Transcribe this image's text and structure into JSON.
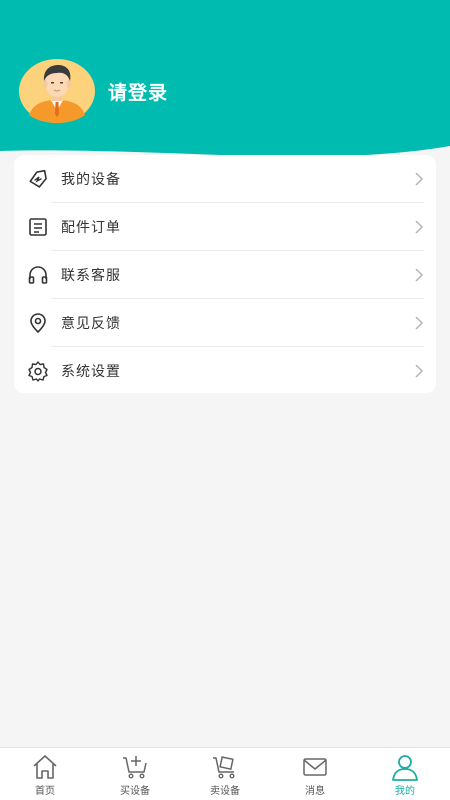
{
  "theme": {
    "accent": "#00bcb0",
    "active_tab": "#1aaea3"
  },
  "header": {
    "avatar_icon": "user-avatar",
    "login_text": "请登录"
  },
  "menu": {
    "items": [
      {
        "label": "我的设备",
        "icon": "device-tag-icon"
      },
      {
        "label": "配件订单",
        "icon": "order-list-icon"
      },
      {
        "label": "联系客服",
        "icon": "headset-icon"
      },
      {
        "label": "意见反馈",
        "icon": "location-pin-icon"
      },
      {
        "label": "系统设置",
        "icon": "gear-icon"
      }
    ]
  },
  "tabbar": {
    "tabs": [
      {
        "label": "首页",
        "icon": "home-icon"
      },
      {
        "label": "买设备",
        "icon": "cart-plus-icon"
      },
      {
        "label": "卖设备",
        "icon": "sell-cart-icon"
      },
      {
        "label": "消息",
        "icon": "mail-icon"
      },
      {
        "label": "我的",
        "icon": "user-icon",
        "active": true
      }
    ]
  }
}
